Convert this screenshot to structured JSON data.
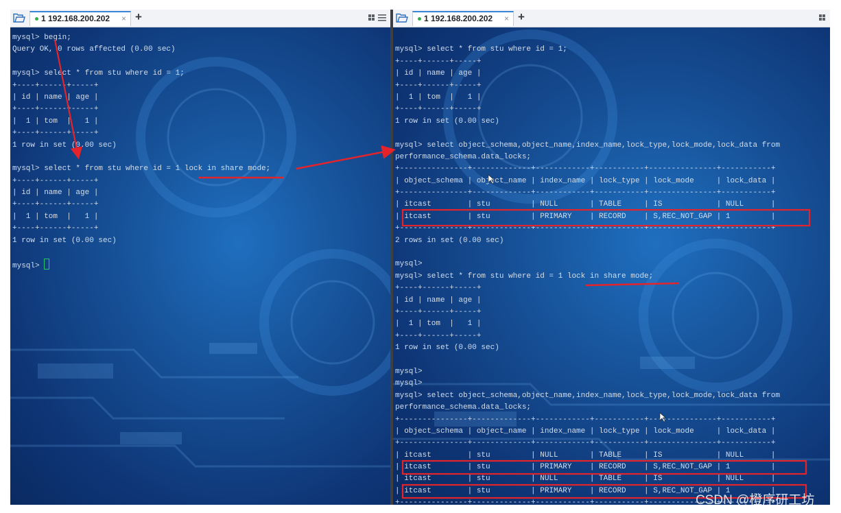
{
  "left_tab": {
    "title": "1 192.168.200.202",
    "close": "×",
    "new": "+"
  },
  "right_tab": {
    "title": "1 192.168.200.202",
    "close": "×",
    "new": "+"
  },
  "left_terminal": [
    "mysql> begin;",
    "Query OK, 0 rows affected (0.00 sec)",
    "",
    "mysql> select * from stu where id = 1;",
    "+----+------+-----+",
    "| id | name | age |",
    "+----+------+-----+",
    "|  1 | tom  |   1 |",
    "+----+------+-----+",
    "1 row in set (0.00 sec)",
    "",
    "mysql> select * from stu where id = 1 lock in share mode;",
    "+----+------+-----+",
    "| id | name | age |",
    "+----+------+-----+",
    "|  1 | tom  |   1 |",
    "+----+------+-----+",
    "1 row in set (0.00 sec)",
    "",
    "mysql> "
  ],
  "right_terminal": [
    "",
    "mysql> select * from stu where id = 1;",
    "+----+------+-----+",
    "| id | name | age |",
    "+----+------+-----+",
    "|  1 | tom  |   1 |",
    "+----+------+-----+",
    "1 row in set (0.00 sec)",
    "",
    "mysql> select object_schema,object_name,index_name,lock_type,lock_mode,lock_data from",
    "performance_schema.data_locks;",
    "+---------------+-------------+------------+-----------+---------------+-----------+",
    "| object_schema | object_name | index_name | lock_type | lock_mode     | lock_data |",
    "+---------------+-------------+------------+-----------+---------------+-----------+",
    "| itcast        | stu         | NULL       | TABLE     | IS            | NULL      |",
    "| itcast        | stu         | PRIMARY    | RECORD    | S,REC_NOT_GAP | 1         |",
    "+---------------+-------------+------------+-----------+---------------+-----------+",
    "2 rows in set (0.00 sec)",
    "",
    "mysql>",
    "mysql> select * from stu where id = 1 lock in share mode;",
    "+----+------+-----+",
    "| id | name | age |",
    "+----+------+-----+",
    "|  1 | tom  |   1 |",
    "+----+------+-----+",
    "1 row in set (0.00 sec)",
    "",
    "mysql>",
    "mysql>",
    "mysql> select object_schema,object_name,index_name,lock_type,lock_mode,lock_data from",
    "performance_schema.data_locks;",
    "+---------------+-------------+------------+-----------+---------------+-----------+",
    "| object_schema | object_name | index_name | lock_type | lock_mode     | lock_data |",
    "+---------------+-------------+------------+-----------+---------------+-----------+",
    "| itcast        | stu         | NULL       | TABLE     | IS            | NULL      |",
    "| itcast        | stu         | PRIMARY    | RECORD    | S,REC_NOT_GAP | 1         |",
    "| itcast        | stu         | NULL       | TABLE     | IS            | NULL      |",
    "| itcast        | stu         | PRIMARY    | RECORD    | S,REC_NOT_GAP | 1         |",
    "+---------------+-------------+------------+-----------+---------------+-----------+"
  ],
  "watermark": "CSDN @橙序研工坊",
  "colors": {
    "terminal_bg": "#164f95",
    "terminal_text": "#d4deea",
    "annotation": "#e5232b",
    "tab_accent": "#3a86d6",
    "tab_dot": "#2fb24c"
  },
  "icons": [
    "folder-icon",
    "layout-icon",
    "cursor-icon",
    "arrow-annotation"
  ]
}
